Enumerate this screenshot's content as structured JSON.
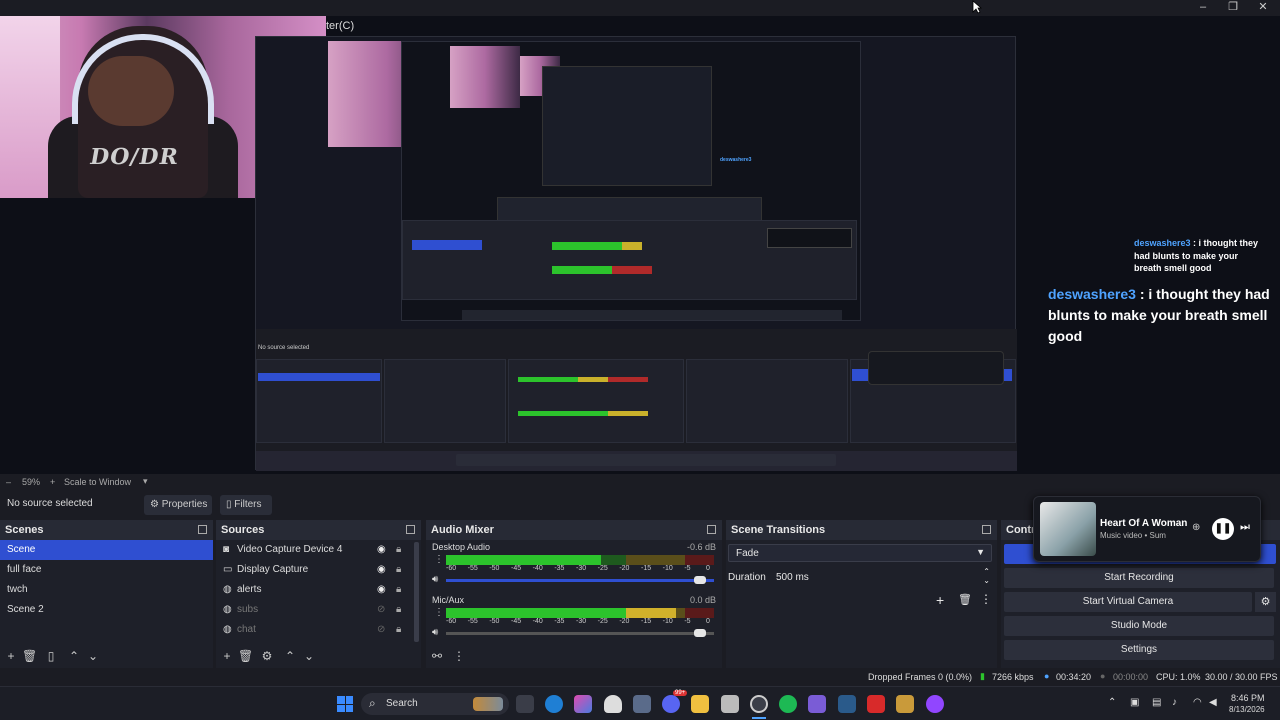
{
  "window": {
    "title_fragment": "ter(C)",
    "controls": {
      "minimize": "–",
      "maximize": "❐",
      "close": "✕"
    }
  },
  "preview": {
    "chat": {
      "user": "deswashere3",
      "separator": " : ",
      "message": "i thought they had blunts to make your breath smell good"
    },
    "webcam_shirt_text": "DO/DR"
  },
  "scale": {
    "zoom": "59%",
    "mode": "Scale to Window"
  },
  "source_bar": {
    "no_source": "No source selected",
    "properties": "Properties",
    "filters": "Filters"
  },
  "scenes": {
    "title": "Scenes",
    "items": [
      "Scene",
      "full face",
      "twch",
      "Scene 2"
    ],
    "selected_index": 0
  },
  "sources": {
    "title": "Sources",
    "items": [
      {
        "label": "Video Capture Device 4",
        "icon": "camera-icon",
        "visible": true
      },
      {
        "label": "Display Capture",
        "icon": "monitor-icon",
        "visible": true
      },
      {
        "label": "alerts",
        "icon": "globe-icon",
        "visible": true
      },
      {
        "label": "subs",
        "icon": "globe-icon",
        "visible": false
      },
      {
        "label": "chat",
        "icon": "globe-icon",
        "visible": false
      }
    ]
  },
  "audio_mixer": {
    "title": "Audio Mixer",
    "channels": [
      {
        "name": "Desktop Audio",
        "db": "-0.6 dB",
        "level": 0.58,
        "slider": 0.97
      },
      {
        "name": "Mic/Aux",
        "db": "0.0 dB",
        "level": 0.86,
        "slider": 0.97
      }
    ],
    "ticks": [
      "-60",
      "-55",
      "-50",
      "-45",
      "-40",
      "-35",
      "-30",
      "-25",
      "-20",
      "-15",
      "-10",
      "-5",
      "0"
    ]
  },
  "transitions": {
    "title": "Scene Transitions",
    "selected": "Fade",
    "duration_label": "Duration",
    "duration_value": "500 ms"
  },
  "controls": {
    "title": "Contro",
    "buttons": [
      "Start Recording",
      "Start Virtual Camera",
      "Studio Mode",
      "Settings"
    ]
  },
  "media": {
    "title": "Heart Of A Woman",
    "subtitle": "Music video • Sum"
  },
  "status": {
    "dropped": "Dropped Frames 0 (0.0%)",
    "bitrate": "7266 kbps",
    "stream_time": "00:34:20",
    "rec_time": "00:00:00",
    "cpu": "CPU: 1.0%",
    "fps": "30.00 / 30.00 FPS"
  },
  "taskbar": {
    "search": "Search",
    "time": "8:46 PM",
    "date": "8/13/2026",
    "badge": "99+",
    "colors": {
      "start": "#3a8bff",
      "accent": "#2f4fd1"
    }
  }
}
